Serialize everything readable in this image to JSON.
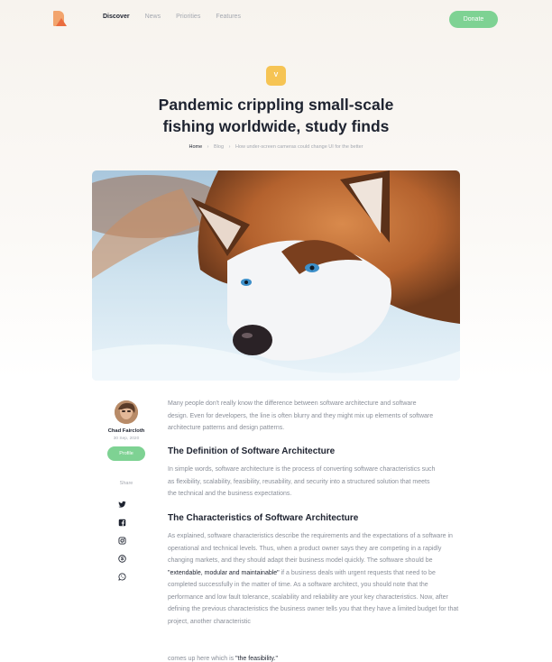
{
  "nav": {
    "links": [
      "Discover",
      "News",
      "Priorities",
      "Features"
    ],
    "active": "Discover",
    "donate_label": "Donate"
  },
  "hero": {
    "badge": "V",
    "title_line1": "Pandemic crippling small-scale",
    "title_line2": "fishing worldwide, study finds"
  },
  "breadcrumb": {
    "home": "Home",
    "blog": "Blog",
    "current": "How under-screen cameras could change UI for the better",
    "separator": "›"
  },
  "author": {
    "name": "Chad Faircloth",
    "date": "30 Sep, 2020",
    "profile_label": "Profile"
  },
  "share": {
    "label": "Share",
    "icons": [
      "twitter-icon",
      "facebook-icon",
      "instagram-icon",
      "skype-icon",
      "whatsapp-icon"
    ]
  },
  "article": {
    "intro": "Many people don't really know the difference between software architecture and software design. Even for developers, the line is often blurry and they might mix up elements of software architecture patterns and design patterns.",
    "heading1": "The Definition of Software Architecture",
    "para1": "In simple words, software architecture is the process of converting software characteristics such as flexibility, scalability, feasibility, reusability, and security into a structured solution that meets the technical and the business expectations.",
    "heading2": "The Characteristics of Software Architecture",
    "para2_a": "As explained, software characteristics describe the requirements and the expectations of a software in operational and technical levels. Thus, when a product owner says they are competing in a rapidly changing markets, and they should adapt their business model quickly. The software should be ",
    "para2_strong": "\"extendable, modular and maintainable\"",
    "para2_b": " if a business deals with urgent requests that need to be completed successfully in the matter of time. As a software architect, you should note that the performance and low fault tolerance, scalability and reliability are your key characteristics. Now, after defining the previous characteristics the business owner tells you that they have a limited budget for that project, another characteristic",
    "para3_a": "comes up here which is ",
    "para3_strong": "\"the feasibility.\""
  },
  "colors": {
    "accent_green": "#7ed293",
    "badge_yellow": "#f6c454",
    "logo_orange": "#f2a46d",
    "text_dark": "#1e2330",
    "text_muted": "#8a8f99"
  }
}
